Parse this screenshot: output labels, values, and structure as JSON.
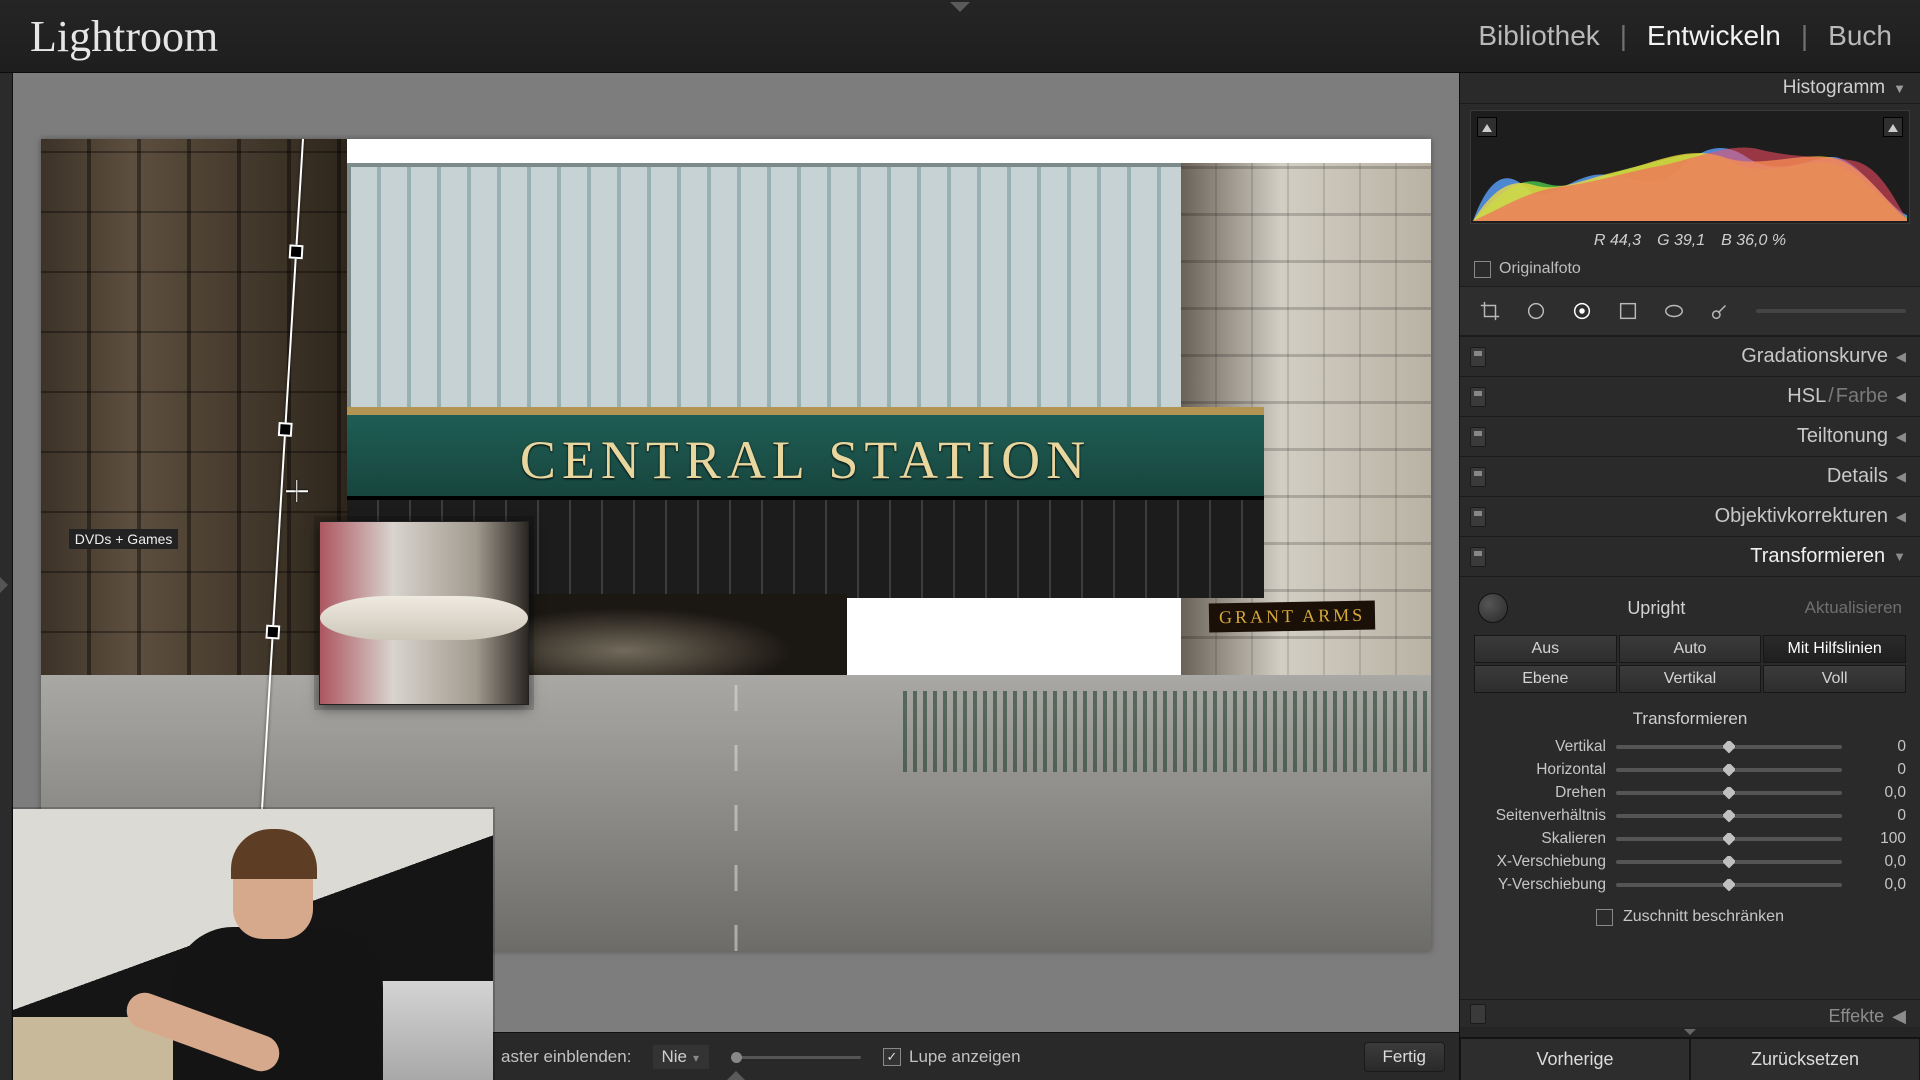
{
  "app": {
    "brand": "Lightroom"
  },
  "modules": {
    "library": "Bibliothek",
    "develop": "Entwickeln",
    "book": "Buch",
    "divider": "|",
    "active": "develop"
  },
  "image": {
    "sign": "CENTRAL STATION",
    "grant_arms": "GRANT ARMS",
    "dvds": "DVDs + Games"
  },
  "toolbar_bottom": {
    "grid_label": "aster einblenden:",
    "grid_value": "Nie",
    "loupe_label": "Lupe anzeigen",
    "loupe_checked": true,
    "done": "Fertig"
  },
  "histogram": {
    "title": "Histogramm",
    "rgb": {
      "r_label": "R",
      "r": "44,3",
      "g_label": "G",
      "g": "39,1",
      "b_label": "B",
      "b": "36,0",
      "pct": "%"
    },
    "original": "Originalfoto"
  },
  "panels": {
    "tone_curve": "Gradationskurve",
    "hsl_a": "HSL",
    "hsl_b": "Farbe",
    "split_tone": "Teiltonung",
    "detail": "Details",
    "lens": "Objektivkorrekturen",
    "transform": "Transformieren",
    "effects": "Effekte"
  },
  "transform": {
    "upright_label": "Upright",
    "update_label": "Aktualisieren",
    "buttons": {
      "off": "Aus",
      "auto": "Auto",
      "guided": "Mit Hilfslinien",
      "level": "Ebene",
      "vertical": "Vertikal",
      "full": "Voll"
    },
    "section_label": "Transformieren",
    "sliders": {
      "vertical": {
        "label": "Vertikal",
        "value": "0"
      },
      "horizontal": {
        "label": "Horizontal",
        "value": "0"
      },
      "rotate": {
        "label": "Drehen",
        "value": "0,0"
      },
      "aspect": {
        "label": "Seitenverhältnis",
        "value": "0"
      },
      "scale": {
        "label": "Skalieren",
        "value": "100"
      },
      "xoff": {
        "label": "X-Verschiebung",
        "value": "0,0"
      },
      "yoff": {
        "label": "Y-Verschiebung",
        "value": "0,0"
      }
    },
    "constrain_crop": "Zuschnitt beschränken"
  },
  "right_footer": {
    "previous": "Vorherige",
    "reset": "Zurücksetzen"
  }
}
